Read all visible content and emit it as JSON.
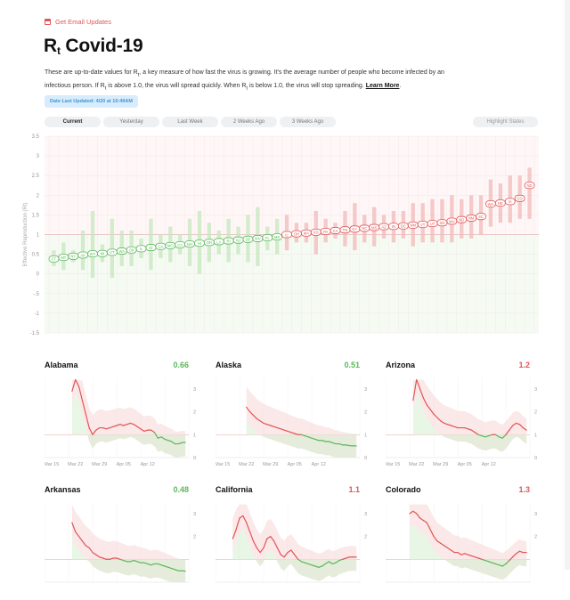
{
  "header": {
    "email_link": "Get Email Updates",
    "title_main": "R",
    "title_sub": "t",
    "title_rest": " Covid-19",
    "intro_1": "These are up-to-date values for R",
    "intro_2": ", a key measure of how fast the virus is growing. It's the average number of people who become infected by an infectious person. If R",
    "intro_3": " is above 1.0, the virus will spread quickly. When R",
    "intro_4": " is below 1.0, the virus will stop spreading. ",
    "intro_link": "Learn More",
    "intro_end": ".",
    "sub_t": "t",
    "date_badge": "Date Last Updated: 4/20 at 10:49AM"
  },
  "tabs": [
    "Current",
    "Yesterday",
    "Last Week",
    "2 Weeks Ago",
    "3 Weeks Ago"
  ],
  "highlight_label": "Highlight States",
  "colors": {
    "green": "#5cb85c",
    "red": "#e15656",
    "green_band": "#d6efd0",
    "red_band": "#f9d9d9"
  },
  "chart_data": [
    {
      "type": "scatter",
      "ylabel": "Effective Reproduction (Rt)",
      "ylim": [
        -1.5,
        3.5
      ],
      "yticks": [
        "3.5",
        "3",
        "2.5",
        "2",
        "1.5",
        "1",
        "0.5",
        "0",
        "-.5",
        "-1",
        "-1.5"
      ],
      "reference_line": 1,
      "states": [
        "CT",
        "MT",
        "NY",
        "AK",
        "WY",
        "MI",
        "VT",
        "WA",
        "OK",
        "IL",
        "ID",
        "GA",
        "MO",
        "CA",
        "NH",
        "HI",
        "OR",
        "LA",
        "RI",
        "NJ",
        "DE",
        "WV",
        "FL",
        "MD",
        "IL",
        "OH",
        "MA",
        "KS",
        "PA",
        "CA",
        "TN",
        "KY",
        "NC",
        "MS",
        "AZ",
        "IN",
        "DC",
        "NM",
        "VT",
        "UT",
        "SD",
        "WV",
        "ND",
        "NM",
        "SC",
        "WA",
        "NE",
        "IA",
        "CO",
        "ND"
      ],
      "values": [
        0.38,
        0.42,
        0.45,
        0.48,
        0.51,
        0.52,
        0.55,
        0.58,
        0.61,
        0.64,
        0.67,
        0.7,
        0.72,
        0.74,
        0.76,
        0.78,
        0.8,
        0.82,
        0.84,
        0.86,
        0.88,
        0.9,
        0.92,
        0.94,
        1.0,
        1.02,
        1.04,
        1.06,
        1.08,
        1.1,
        1.12,
        1.14,
        1.16,
        1.18,
        1.2,
        1.21,
        1.22,
        1.24,
        1.26,
        1.28,
        1.3,
        1.34,
        1.38,
        1.42,
        1.46,
        1.78,
        1.8,
        1.84,
        1.92,
        2.25
      ],
      "ranges": [
        [
          0.2,
          0.6
        ],
        [
          0.1,
          0.8
        ],
        [
          0.3,
          0.6
        ],
        [
          0.1,
          1.1
        ],
        [
          -0.1,
          1.6
        ],
        [
          0.3,
          0.75
        ],
        [
          -0.1,
          1.4
        ],
        [
          0.2,
          1.1
        ],
        [
          0.2,
          1.1
        ],
        [
          0.4,
          0.9
        ],
        [
          0.1,
          1.4
        ],
        [
          0.4,
          1.0
        ],
        [
          0.3,
          1.2
        ],
        [
          0.5,
          1.0
        ],
        [
          0.2,
          1.4
        ],
        [
          0.0,
          1.6
        ],
        [
          0.3,
          1.3
        ],
        [
          0.5,
          1.1
        ],
        [
          0.3,
          1.4
        ],
        [
          0.5,
          1.2
        ],
        [
          0.3,
          1.5
        ],
        [
          0.2,
          1.7
        ],
        [
          0.6,
          1.2
        ],
        [
          0.5,
          1.4
        ],
        [
          0.6,
          1.5
        ],
        [
          0.8,
          1.3
        ],
        [
          0.8,
          1.3
        ],
        [
          0.5,
          1.6
        ],
        [
          0.8,
          1.4
        ],
        [
          0.9,
          1.3
        ],
        [
          0.7,
          1.6
        ],
        [
          0.6,
          1.8
        ],
        [
          0.8,
          1.5
        ],
        [
          0.7,
          1.7
        ],
        [
          0.9,
          1.5
        ],
        [
          0.8,
          1.6
        ],
        [
          0.9,
          1.6
        ],
        [
          0.7,
          1.8
        ],
        [
          0.8,
          1.8
        ],
        [
          0.8,
          1.9
        ],
        [
          0.8,
          1.9
        ],
        [
          0.8,
          2.0
        ],
        [
          0.9,
          1.9
        ],
        [
          0.9,
          2.0
        ],
        [
          1.0,
          2.0
        ],
        [
          1.2,
          2.4
        ],
        [
          1.3,
          2.3
        ],
        [
          1.3,
          2.5
        ],
        [
          1.4,
          2.5
        ],
        [
          1.4,
          2.7
        ]
      ]
    },
    {
      "type": "line",
      "state": "Alabama",
      "value": "0.66",
      "xticks": [
        "Mar 15",
        "Mar 22",
        "Mar 29",
        "Apr 05",
        "Apr 12"
      ],
      "ylim": [
        0,
        3.5
      ],
      "yticks": [
        "3",
        "2",
        "1",
        "0"
      ],
      "x": [
        8,
        9,
        10,
        11,
        12,
        13,
        14,
        15,
        16,
        17,
        18,
        19,
        20,
        21,
        22,
        23,
        24,
        25,
        26,
        27,
        28,
        29,
        30,
        31,
        32,
        33,
        34,
        35,
        36,
        37,
        38,
        39,
        40,
        41
      ],
      "y": [
        2.9,
        3.4,
        3.1,
        2.5,
        1.9,
        1.3,
        1.0,
        1.2,
        1.3,
        1.3,
        1.25,
        1.3,
        1.35,
        1.4,
        1.45,
        1.4,
        1.45,
        1.5,
        1.45,
        1.35,
        1.25,
        1.15,
        1.2,
        1.2,
        1.1,
        0.85,
        0.9,
        0.8,
        0.75,
        0.7,
        0.6,
        0.6,
        0.65,
        0.66
      ],
      "last_value": 0.66
    },
    {
      "type": "line",
      "state": "Alaska",
      "value": "0.51",
      "xticks": [
        "Mar 15",
        "Mar 22",
        "Mar 29",
        "Apr 05",
        "Apr 12"
      ],
      "ylim": [
        0,
        3.5
      ],
      "yticks": [
        "3",
        "2",
        "1",
        "0"
      ],
      "x": [
        9,
        10,
        11,
        12,
        13,
        14,
        15,
        16,
        17,
        18,
        19,
        20,
        21,
        22,
        23,
        24,
        25,
        26,
        27,
        28,
        29,
        30,
        31,
        32,
        33,
        34,
        35,
        36,
        37,
        38,
        39,
        40,
        41
      ],
      "y": [
        2.2,
        2.0,
        1.85,
        1.7,
        1.6,
        1.5,
        1.45,
        1.4,
        1.35,
        1.3,
        1.25,
        1.2,
        1.15,
        1.1,
        1.05,
        1.0,
        1.0,
        0.95,
        0.9,
        0.85,
        0.8,
        0.75,
        0.75,
        0.7,
        0.7,
        0.65,
        0.6,
        0.6,
        0.55,
        0.55,
        0.52,
        0.51,
        0.51
      ],
      "last_value": 0.51
    },
    {
      "type": "line",
      "state": "Arizona",
      "value": "1.2",
      "xticks": [
        "Mar 15",
        "Mar 22",
        "Mar 29",
        "Apr 05",
        "Apr 12"
      ],
      "ylim": [
        0,
        3.5
      ],
      "yticks": [
        "3",
        "2",
        "1",
        "0"
      ],
      "x": [
        8,
        9,
        10,
        11,
        12,
        13,
        14,
        15,
        16,
        17,
        18,
        19,
        20,
        21,
        22,
        23,
        24,
        25,
        26,
        27,
        28,
        29,
        30,
        31,
        32,
        33,
        34,
        35,
        36,
        37,
        38,
        39,
        40,
        41
      ],
      "y": [
        2.5,
        3.4,
        3.0,
        2.6,
        2.3,
        2.1,
        1.9,
        1.75,
        1.6,
        1.5,
        1.45,
        1.4,
        1.35,
        1.3,
        1.3,
        1.3,
        1.25,
        1.2,
        1.1,
        1.0,
        0.95,
        0.9,
        0.95,
        1.0,
        1.0,
        0.9,
        0.85,
        1.0,
        1.2,
        1.4,
        1.5,
        1.45,
        1.3,
        1.2
      ],
      "last_value": 1.2
    },
    {
      "type": "line",
      "state": "Arkansas",
      "value": "0.48",
      "ylim": [
        0,
        3.5
      ],
      "yticks": [
        "3",
        "2"
      ],
      "x": [
        8,
        9,
        10,
        11,
        12,
        13,
        14,
        15,
        16,
        17,
        18,
        19,
        20,
        21,
        22,
        23,
        24,
        25,
        26,
        27,
        28,
        29,
        30,
        31,
        32,
        33,
        34,
        35,
        36,
        37,
        38,
        39,
        40,
        41
      ],
      "y": [
        2.6,
        2.2,
        2.0,
        1.8,
        1.6,
        1.5,
        1.3,
        1.2,
        1.1,
        1.05,
        1.0,
        1.0,
        1.05,
        1.05,
        1.0,
        0.95,
        0.9,
        0.9,
        0.95,
        0.9,
        0.85,
        0.85,
        0.8,
        0.75,
        0.8,
        0.8,
        0.75,
        0.7,
        0.65,
        0.6,
        0.55,
        0.5,
        0.5,
        0.48
      ],
      "last_value": 0.48
    },
    {
      "type": "line",
      "state": "California",
      "value": "1.1",
      "ylim": [
        0,
        3.5
      ],
      "yticks": [
        "3",
        "2"
      ],
      "x": [
        5,
        6,
        7,
        8,
        9,
        10,
        11,
        12,
        13,
        14,
        15,
        16,
        17,
        18,
        19,
        20,
        21,
        22,
        23,
        24,
        25,
        26,
        27,
        28,
        29,
        30,
        31,
        32,
        33,
        34,
        35,
        36,
        37,
        38,
        39,
        40,
        41
      ],
      "y": [
        1.9,
        2.3,
        2.8,
        2.9,
        2.6,
        2.2,
        1.8,
        1.5,
        1.3,
        1.5,
        1.9,
        2.0,
        1.8,
        1.5,
        1.2,
        1.1,
        1.3,
        1.4,
        1.2,
        1.0,
        0.9,
        0.85,
        0.8,
        0.75,
        0.7,
        0.65,
        0.7,
        0.8,
        0.9,
        0.8,
        0.85,
        0.95,
        1.0,
        1.05,
        1.1,
        1.1,
        1.1
      ],
      "last_value": 1.1
    },
    {
      "type": "line",
      "state": "Colorado",
      "value": "1.3",
      "ylim": [
        0,
        3.5
      ],
      "yticks": [
        "3",
        "2"
      ],
      "x": [
        7,
        8,
        9,
        10,
        11,
        12,
        13,
        14,
        15,
        16,
        17,
        18,
        19,
        20,
        21,
        22,
        23,
        24,
        25,
        26,
        27,
        28,
        29,
        30,
        31,
        32,
        33,
        34,
        35,
        36,
        37,
        38,
        39,
        40,
        41
      ],
      "y": [
        3.0,
        3.1,
        3.0,
        2.8,
        2.7,
        2.6,
        2.3,
        2.0,
        1.8,
        1.7,
        1.6,
        1.5,
        1.4,
        1.3,
        1.3,
        1.2,
        1.25,
        1.2,
        1.15,
        1.1,
        1.05,
        1.0,
        0.95,
        0.9,
        0.85,
        0.8,
        0.75,
        0.7,
        0.8,
        0.95,
        1.1,
        1.25,
        1.35,
        1.3,
        1.3
      ],
      "last_value": 1.3
    }
  ]
}
